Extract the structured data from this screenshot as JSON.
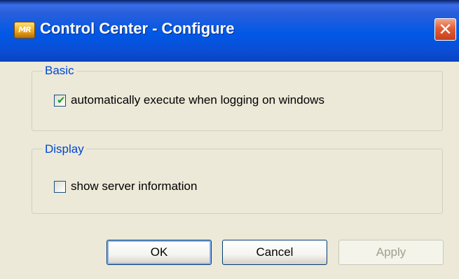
{
  "window": {
    "title": "Control Center - Configure",
    "app_icon_text": "MR",
    "close_glyph": "✕"
  },
  "groups": {
    "basic": {
      "legend": "Basic",
      "option": {
        "label": "automatically execute when logging on windows",
        "checked": true
      }
    },
    "display": {
      "legend": "Display",
      "option": {
        "label": "show server information",
        "checked": false
      }
    }
  },
  "buttons": {
    "ok": "OK",
    "cancel": "Cancel",
    "apply": "Apply"
  },
  "colors": {
    "titlebar": "#0058e6",
    "legend_text": "#0046d5",
    "check_mark": "#21a121",
    "close_button": "#e35d33"
  }
}
